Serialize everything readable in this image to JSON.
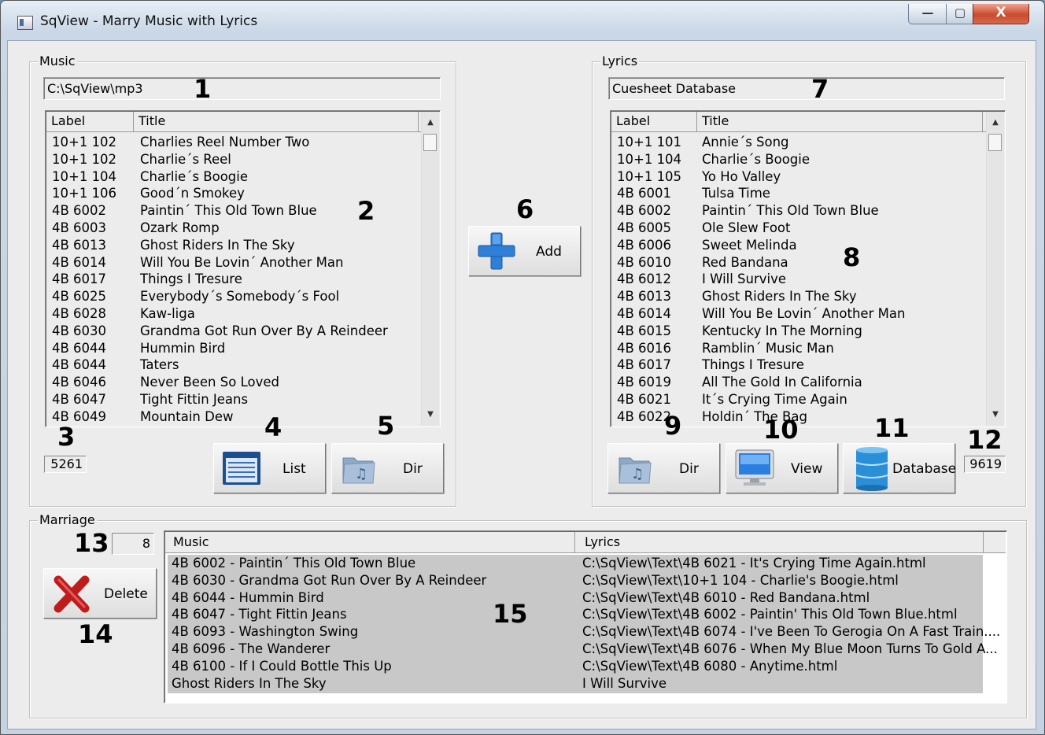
{
  "window": {
    "title": "SqView - Marry Music with Lyrics",
    "min": "—",
    "max": "▢",
    "close": "X"
  },
  "music": {
    "group_label": "Music",
    "path": "C:\\SqView\\mp3",
    "columns": [
      "Label",
      "Title"
    ],
    "rows": [
      [
        "10+1 102",
        "Charlies Reel Number Two"
      ],
      [
        "10+1 102",
        "Charlie´s Reel"
      ],
      [
        "10+1 104",
        "Charlie´s Boogie"
      ],
      [
        "10+1 106",
        "Good´n Smokey"
      ],
      [
        "4B 6002",
        "Paintin´ This Old Town Blue"
      ],
      [
        "4B 6003",
        "Ozark Romp"
      ],
      [
        "4B 6013",
        "Ghost Riders In The Sky"
      ],
      [
        "4B 6014",
        "Will You Be Lovin´ Another Man"
      ],
      [
        "4B 6017",
        "Things I Tresure"
      ],
      [
        "4B 6025",
        "Everybody´s Somebody´s Fool"
      ],
      [
        "4B 6028",
        "Kaw-liga"
      ],
      [
        "4B 6030",
        "Grandma Got Run Over By A Reindeer"
      ],
      [
        "4B 6044",
        "Hummin Bird"
      ],
      [
        "4B 6044",
        "Taters"
      ],
      [
        "4B 6046",
        "Never Been So Loved"
      ],
      [
        "4B 6047",
        "Tight Fittin Jeans"
      ],
      [
        "4B 6049",
        "Mountain Dew"
      ]
    ],
    "count": "5261",
    "list_button": "List",
    "dir_button": "Dir"
  },
  "add_button": "Add",
  "lyrics": {
    "group_label": "Lyrics",
    "source": "Cuesheet Database",
    "columns": [
      "Label",
      "Title"
    ],
    "rows": [
      [
        "10+1 101",
        "Annie´s Song"
      ],
      [
        "10+1 104",
        "Charlie´s Boogie"
      ],
      [
        "10+1 105",
        "Yo Ho Valley"
      ],
      [
        "4B 6001",
        "Tulsa Time"
      ],
      [
        "4B 6002",
        "Paintin´ This Old Town Blue"
      ],
      [
        "4B 6005",
        "Ole Slew Foot"
      ],
      [
        "4B 6006",
        "Sweet Melinda"
      ],
      [
        "4B 6010",
        "Red Bandana"
      ],
      [
        "4B 6012",
        "I Will Survive"
      ],
      [
        "4B 6013",
        "Ghost Riders In The Sky"
      ],
      [
        "4B 6014",
        "Will You Be Lovin´ Another Man"
      ],
      [
        "4B 6015",
        "Kentucky In The Morning"
      ],
      [
        "4B 6016",
        "Ramblin´ Music Man"
      ],
      [
        "4B 6017",
        "Things I Tresure"
      ],
      [
        "4B 6019",
        "All The Gold In California"
      ],
      [
        "4B 6021",
        "It´s Crying Time Again"
      ],
      [
        "4B 6022",
        "Holdin´ The Bag"
      ]
    ],
    "count": "9619",
    "dir_button": "Dir",
    "view_button": "View",
    "database_button": "Database"
  },
  "marriage": {
    "group_label": "Marriage",
    "count": "8",
    "delete_button": "Delete",
    "columns": [
      "Music",
      "Lyrics"
    ],
    "rows": [
      [
        "4B 6002 - Paintin´ This Old Town Blue",
        "C:\\SqView\\Text\\4B 6021 - It's Crying Time Again.html"
      ],
      [
        "4B 6030 - Grandma Got Run Over By A Reindeer",
        "C:\\SqView\\Text\\10+1 104 - Charlie's Boogie.html"
      ],
      [
        "4B 6044 - Hummin Bird",
        "C:\\SqView\\Text\\4B 6010 - Red Bandana.html"
      ],
      [
        "4B 6047 - Tight Fittin Jeans",
        "C:\\SqView\\Text\\4B 6002 - Paintin' This Old Town Blue.html"
      ],
      [
        "4B 6093 - Washington Swing",
        "C:\\SqView\\Text\\4B 6074 - I've Been To Gerogia On A Fast Train...."
      ],
      [
        "4B 6096 - The Wanderer",
        "C:\\SqView\\Text\\4B 6076 - When My Blue Moon Turns To Gold A..."
      ],
      [
        "4B 6100 - If I Could Bottle This Up",
        "C:\\SqView\\Text\\4B 6080 - Anytime.html"
      ],
      [
        "Ghost Riders In The Sky",
        "I Will Survive"
      ]
    ]
  },
  "callouts": [
    "1",
    "2",
    "3",
    "4",
    "5",
    "6",
    "7",
    "8",
    "9",
    "10",
    "11",
    "12",
    "13",
    "14",
    "15"
  ],
  "colors": {
    "selection": "#c8c8c8",
    "add_blue": "#2f7fd6",
    "delete_red": "#c01b1b",
    "database_blue": "#2b8fd8"
  }
}
